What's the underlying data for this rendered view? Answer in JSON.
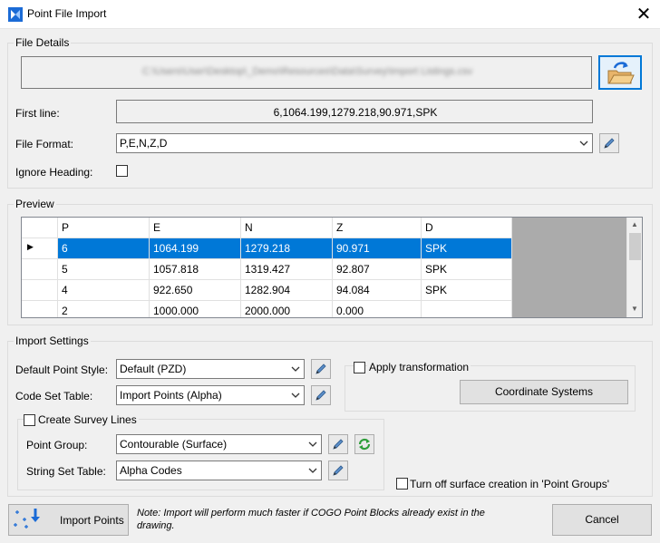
{
  "window": {
    "title": "Point File Import",
    "close_glyph": "✕",
    "app_icon": "bricscad-logo-icon"
  },
  "file_details": {
    "section_label": "File Details",
    "file_path": "C:\\Users\\User\\Desktop\\_Demo\\Resources\\Data\\Survey\\Import Listings.csv",
    "first_line_label": "First line:",
    "first_line_value": "6,1064.199,1279.218,90.971,SPK",
    "file_format_label": "File Format:",
    "file_format_value": "P,E,N,Z,D",
    "ignore_heading_label": "Ignore Heading:",
    "ignore_heading_checked": false
  },
  "preview": {
    "section_label": "Preview",
    "columns": [
      "P",
      "E",
      "N",
      "Z",
      "D"
    ],
    "rows": [
      [
        "6",
        "1064.199",
        "1279.218",
        "90.971",
        "SPK"
      ],
      [
        "5",
        "1057.818",
        "1319.427",
        "92.807",
        "SPK"
      ],
      [
        "4",
        "922.650",
        "1282.904",
        "94.084",
        "SPK"
      ],
      [
        "2",
        "1000.000",
        "2000.000",
        "0.000",
        ""
      ]
    ],
    "selected_row": 0,
    "row_marker": "▶",
    "scroll_up": "▲",
    "scroll_down": "▼"
  },
  "import_settings": {
    "section_label": "Import Settings",
    "default_point_style_label": "Default Point Style:",
    "default_point_style_value": "Default (PZD)",
    "code_set_table_label": "Code Set Table:",
    "code_set_table_value": "Import Points (Alpha)",
    "apply_transformation_label": "Apply transformation",
    "apply_transformation_checked": false,
    "coordinate_systems_button": "Coordinate Systems",
    "create_survey_lines_label": "Create Survey Lines",
    "create_survey_lines_checked": false,
    "point_group_label": "Point Group:",
    "point_group_value": "Contourable (Surface)",
    "string_set_table_label": "String Set Table:",
    "string_set_table_value": "Alpha Codes",
    "turn_off_surface_label": "Turn off surface creation in 'Point Groups'",
    "turn_off_surface_checked": false
  },
  "footer": {
    "import_button": "Import Points",
    "note": "Note: Import will perform much faster if COGO Point Blocks already exist in the drawing.",
    "cancel_button": "Cancel"
  },
  "colors": {
    "selection": "#0078d7",
    "accent_border": "#0078d7",
    "dialog_bg": "#f0f0f0",
    "refresh_green": "#2e9e3a"
  }
}
